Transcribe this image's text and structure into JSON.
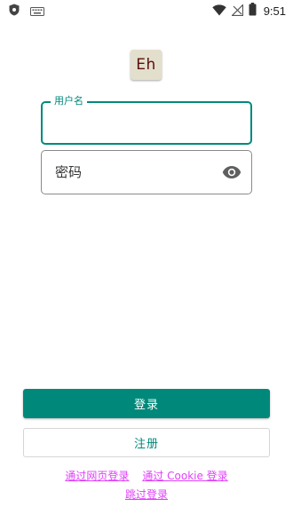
{
  "status_bar": {
    "time": "9:51",
    "icons": [
      "shield-icon",
      "keyboard-icon",
      "wifi-icon",
      "no-signal-icon",
      "battery-icon"
    ]
  },
  "logo": {
    "text": "Eh"
  },
  "form": {
    "username_label": "用户名",
    "username_value": "",
    "password_placeholder": "密码",
    "password_value": ""
  },
  "buttons": {
    "login": "登录",
    "register": "注册"
  },
  "links": {
    "web_login": "通过网页登录",
    "cookie_login": "通过 Cookie 登录",
    "skip_login": "跳过登录"
  },
  "colors": {
    "accent": "#00897b",
    "link": "#e040fb",
    "logo_bg": "#e3dfcd",
    "logo_text": "#5c0d0d"
  }
}
